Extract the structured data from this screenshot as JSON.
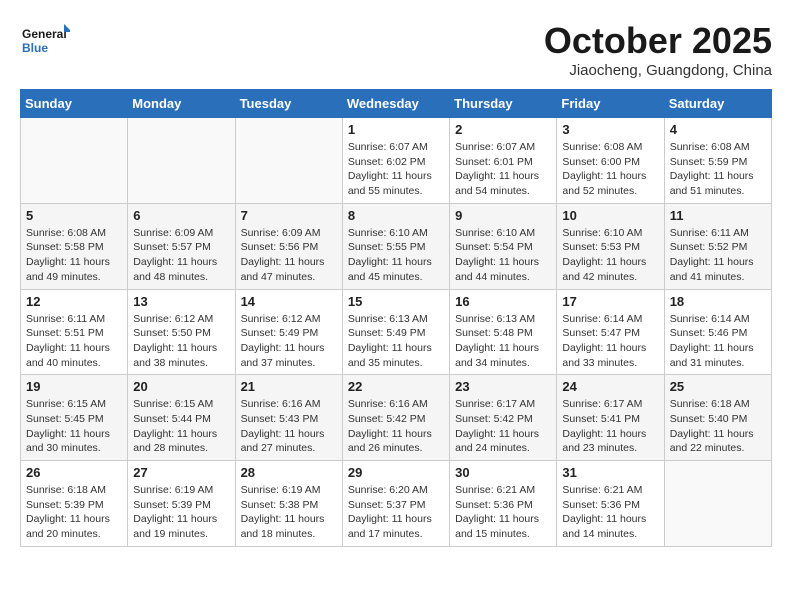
{
  "header": {
    "logo_line1": "General",
    "logo_line2": "Blue",
    "month": "October 2025",
    "location": "Jiaocheng, Guangdong, China"
  },
  "weekdays": [
    "Sunday",
    "Monday",
    "Tuesday",
    "Wednesday",
    "Thursday",
    "Friday",
    "Saturday"
  ],
  "weeks": [
    [
      {
        "day": "",
        "info": ""
      },
      {
        "day": "",
        "info": ""
      },
      {
        "day": "",
        "info": ""
      },
      {
        "day": "1",
        "info": "Sunrise: 6:07 AM\nSunset: 6:02 PM\nDaylight: 11 hours\nand 55 minutes."
      },
      {
        "day": "2",
        "info": "Sunrise: 6:07 AM\nSunset: 6:01 PM\nDaylight: 11 hours\nand 54 minutes."
      },
      {
        "day": "3",
        "info": "Sunrise: 6:08 AM\nSunset: 6:00 PM\nDaylight: 11 hours\nand 52 minutes."
      },
      {
        "day": "4",
        "info": "Sunrise: 6:08 AM\nSunset: 5:59 PM\nDaylight: 11 hours\nand 51 minutes."
      }
    ],
    [
      {
        "day": "5",
        "info": "Sunrise: 6:08 AM\nSunset: 5:58 PM\nDaylight: 11 hours\nand 49 minutes."
      },
      {
        "day": "6",
        "info": "Sunrise: 6:09 AM\nSunset: 5:57 PM\nDaylight: 11 hours\nand 48 minutes."
      },
      {
        "day": "7",
        "info": "Sunrise: 6:09 AM\nSunset: 5:56 PM\nDaylight: 11 hours\nand 47 minutes."
      },
      {
        "day": "8",
        "info": "Sunrise: 6:10 AM\nSunset: 5:55 PM\nDaylight: 11 hours\nand 45 minutes."
      },
      {
        "day": "9",
        "info": "Sunrise: 6:10 AM\nSunset: 5:54 PM\nDaylight: 11 hours\nand 44 minutes."
      },
      {
        "day": "10",
        "info": "Sunrise: 6:10 AM\nSunset: 5:53 PM\nDaylight: 11 hours\nand 42 minutes."
      },
      {
        "day": "11",
        "info": "Sunrise: 6:11 AM\nSunset: 5:52 PM\nDaylight: 11 hours\nand 41 minutes."
      }
    ],
    [
      {
        "day": "12",
        "info": "Sunrise: 6:11 AM\nSunset: 5:51 PM\nDaylight: 11 hours\nand 40 minutes."
      },
      {
        "day": "13",
        "info": "Sunrise: 6:12 AM\nSunset: 5:50 PM\nDaylight: 11 hours\nand 38 minutes."
      },
      {
        "day": "14",
        "info": "Sunrise: 6:12 AM\nSunset: 5:49 PM\nDaylight: 11 hours\nand 37 minutes."
      },
      {
        "day": "15",
        "info": "Sunrise: 6:13 AM\nSunset: 5:49 PM\nDaylight: 11 hours\nand 35 minutes."
      },
      {
        "day": "16",
        "info": "Sunrise: 6:13 AM\nSunset: 5:48 PM\nDaylight: 11 hours\nand 34 minutes."
      },
      {
        "day": "17",
        "info": "Sunrise: 6:14 AM\nSunset: 5:47 PM\nDaylight: 11 hours\nand 33 minutes."
      },
      {
        "day": "18",
        "info": "Sunrise: 6:14 AM\nSunset: 5:46 PM\nDaylight: 11 hours\nand 31 minutes."
      }
    ],
    [
      {
        "day": "19",
        "info": "Sunrise: 6:15 AM\nSunset: 5:45 PM\nDaylight: 11 hours\nand 30 minutes."
      },
      {
        "day": "20",
        "info": "Sunrise: 6:15 AM\nSunset: 5:44 PM\nDaylight: 11 hours\nand 28 minutes."
      },
      {
        "day": "21",
        "info": "Sunrise: 6:16 AM\nSunset: 5:43 PM\nDaylight: 11 hours\nand 27 minutes."
      },
      {
        "day": "22",
        "info": "Sunrise: 6:16 AM\nSunset: 5:42 PM\nDaylight: 11 hours\nand 26 minutes."
      },
      {
        "day": "23",
        "info": "Sunrise: 6:17 AM\nSunset: 5:42 PM\nDaylight: 11 hours\nand 24 minutes."
      },
      {
        "day": "24",
        "info": "Sunrise: 6:17 AM\nSunset: 5:41 PM\nDaylight: 11 hours\nand 23 minutes."
      },
      {
        "day": "25",
        "info": "Sunrise: 6:18 AM\nSunset: 5:40 PM\nDaylight: 11 hours\nand 22 minutes."
      }
    ],
    [
      {
        "day": "26",
        "info": "Sunrise: 6:18 AM\nSunset: 5:39 PM\nDaylight: 11 hours\nand 20 minutes."
      },
      {
        "day": "27",
        "info": "Sunrise: 6:19 AM\nSunset: 5:39 PM\nDaylight: 11 hours\nand 19 minutes."
      },
      {
        "day": "28",
        "info": "Sunrise: 6:19 AM\nSunset: 5:38 PM\nDaylight: 11 hours\nand 18 minutes."
      },
      {
        "day": "29",
        "info": "Sunrise: 6:20 AM\nSunset: 5:37 PM\nDaylight: 11 hours\nand 17 minutes."
      },
      {
        "day": "30",
        "info": "Sunrise: 6:21 AM\nSunset: 5:36 PM\nDaylight: 11 hours\nand 15 minutes."
      },
      {
        "day": "31",
        "info": "Sunrise: 6:21 AM\nSunset: 5:36 PM\nDaylight: 11 hours\nand 14 minutes."
      },
      {
        "day": "",
        "info": ""
      }
    ]
  ]
}
